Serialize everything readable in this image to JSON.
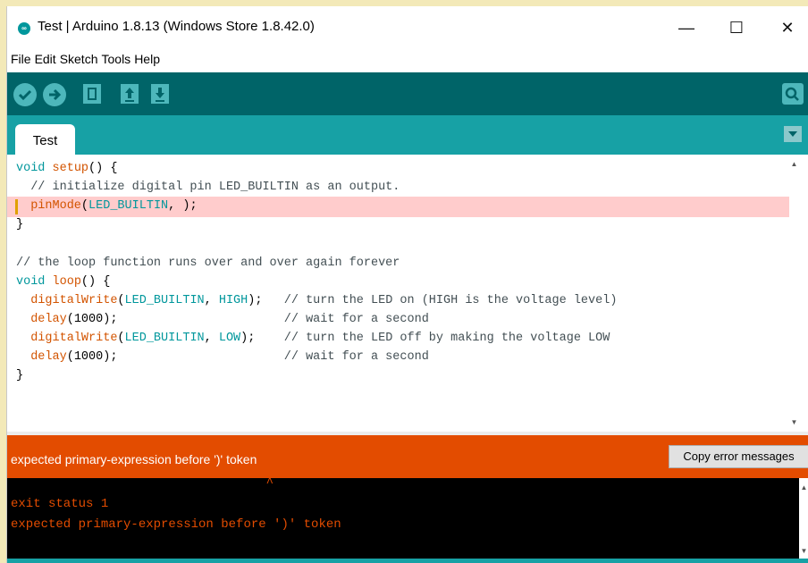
{
  "window": {
    "title": "Test | Arduino 1.8.13 (Windows Store 1.8.42.0)",
    "app_icon": "∞",
    "controls": {
      "minimize": "—",
      "maximize": "☐",
      "close": "✕"
    }
  },
  "menu": [
    "File",
    "Edit",
    "Sketch",
    "Tools",
    "Help"
  ],
  "toolbar": {
    "verify_icon": "checkmark-icon",
    "upload_icon": "arrow-right-icon",
    "new_icon": "document-icon",
    "open_icon": "arrow-up-icon",
    "save_icon": "arrow-down-icon",
    "serial_icon": "magnifier-icon"
  },
  "tabs": [
    {
      "label": "Test"
    }
  ],
  "code_lines": [
    [
      {
        "t": "void ",
        "c": "kw"
      },
      {
        "t": "setup",
        "c": "fn"
      },
      {
        "t": "() {",
        "c": ""
      }
    ],
    [
      {
        "t": "  // initialize digital pin LED_BUILTIN as an output.",
        "c": "cm"
      }
    ],
    [
      {
        "t": "  ",
        "c": ""
      },
      {
        "t": "pinMode",
        "c": "fn"
      },
      {
        "t": "(",
        "c": ""
      },
      {
        "t": "LED_BUILTIN",
        "c": "cst"
      },
      {
        "t": ", );",
        "c": ""
      }
    ],
    [
      {
        "t": "}",
        "c": ""
      }
    ],
    [
      {
        "t": "",
        "c": ""
      }
    ],
    [
      {
        "t": "// the loop function runs over and over again forever",
        "c": "cm"
      }
    ],
    [
      {
        "t": "void ",
        "c": "kw"
      },
      {
        "t": "loop",
        "c": "fn"
      },
      {
        "t": "() {",
        "c": ""
      }
    ],
    [
      {
        "t": "  ",
        "c": ""
      },
      {
        "t": "digitalWrite",
        "c": "fn"
      },
      {
        "t": "(",
        "c": ""
      },
      {
        "t": "LED_BUILTIN",
        "c": "cst"
      },
      {
        "t": ", ",
        "c": ""
      },
      {
        "t": "HIGH",
        "c": "cst"
      },
      {
        "t": ");   ",
        "c": ""
      },
      {
        "t": "// turn the LED on (HIGH is the voltage level)",
        "c": "cm"
      }
    ],
    [
      {
        "t": "  ",
        "c": ""
      },
      {
        "t": "delay",
        "c": "fn"
      },
      {
        "t": "(1000);                       ",
        "c": ""
      },
      {
        "t": "// wait for a second",
        "c": "cm"
      }
    ],
    [
      {
        "t": "  ",
        "c": ""
      },
      {
        "t": "digitalWrite",
        "c": "fn"
      },
      {
        "t": "(",
        "c": ""
      },
      {
        "t": "LED_BUILTIN",
        "c": "cst"
      },
      {
        "t": ", ",
        "c": ""
      },
      {
        "t": "LOW",
        "c": "cst"
      },
      {
        "t": ");    ",
        "c": ""
      },
      {
        "t": "// turn the LED off by making the voltage LOW",
        "c": "cm"
      }
    ],
    [
      {
        "t": "  ",
        "c": ""
      },
      {
        "t": "delay",
        "c": "fn"
      },
      {
        "t": "(1000);                       ",
        "c": ""
      },
      {
        "t": "// wait for a second",
        "c": "cm"
      }
    ],
    [
      {
        "t": "}",
        "c": ""
      }
    ]
  ],
  "error_bar": {
    "message": "expected primary-expression before ')' token",
    "copy_button": "Copy error messages"
  },
  "console": {
    "lines": [
      "                                  ^",
      "exit status 1",
      "expected primary-expression before ')' token"
    ]
  },
  "colors": {
    "toolbar": "#006468",
    "tabbar": "#17a1a5",
    "error": "#e34c00",
    "error_line": "#ffcccc"
  }
}
